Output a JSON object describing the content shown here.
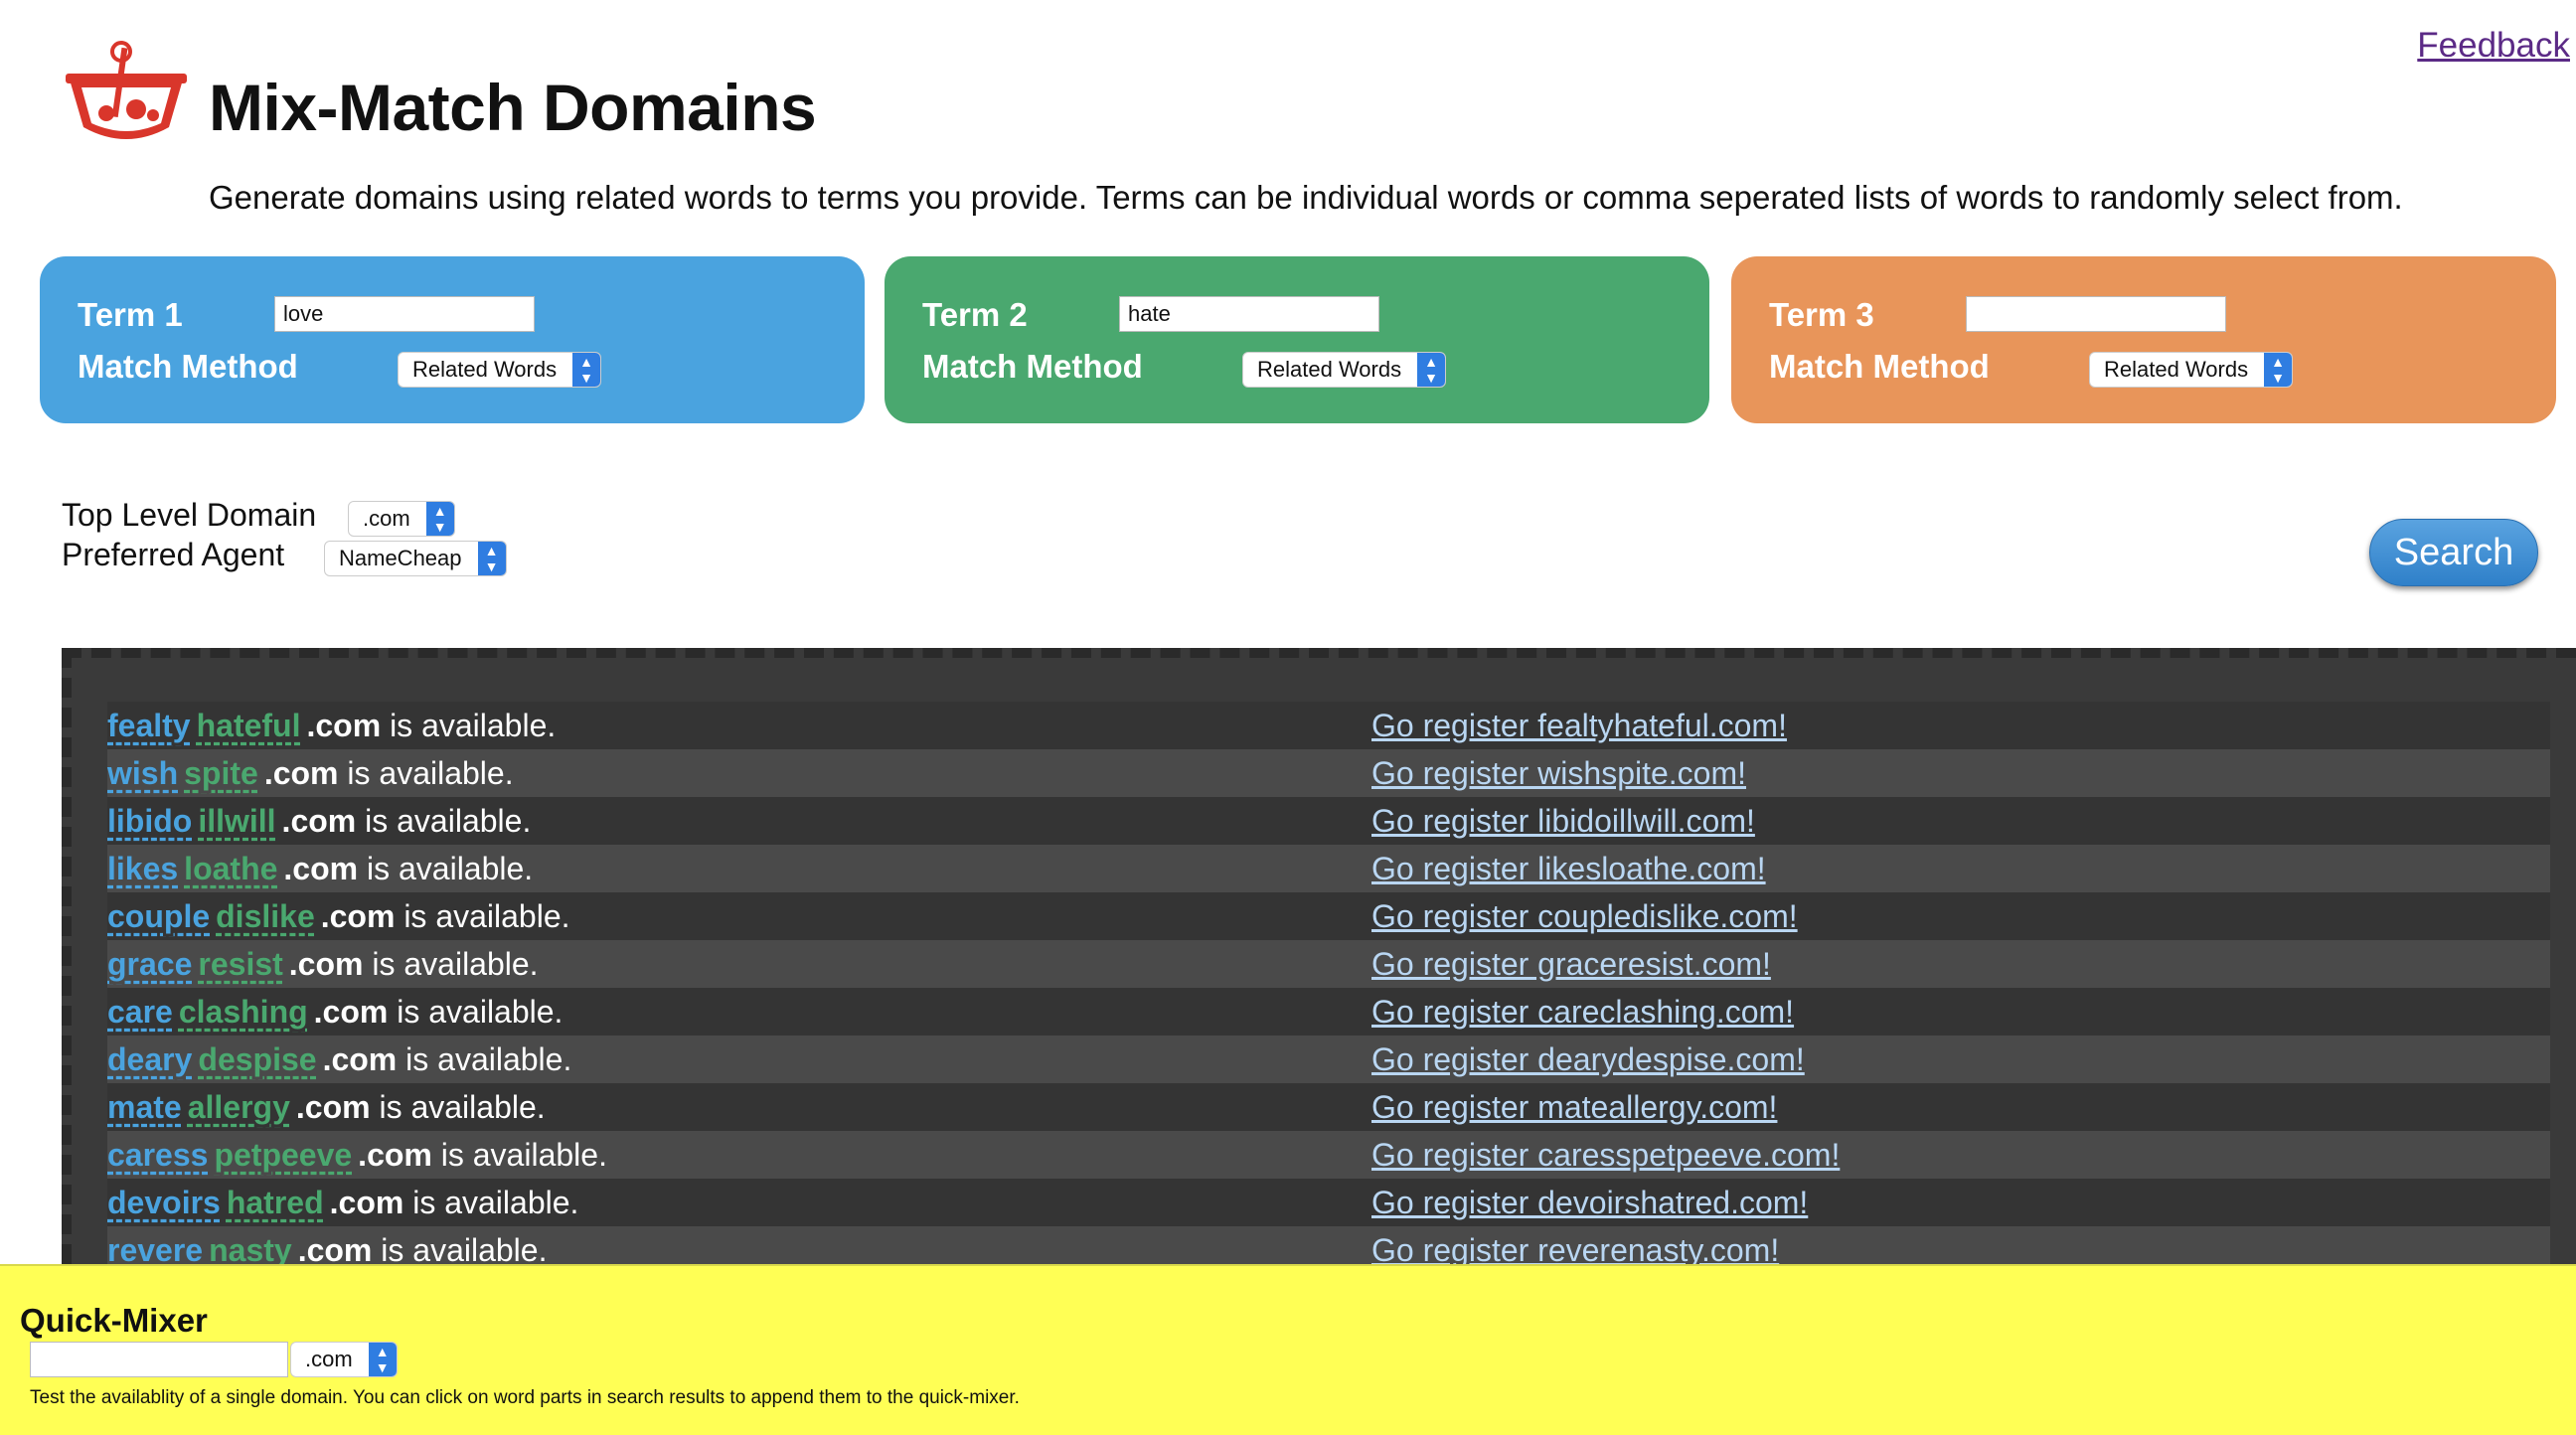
{
  "header": {
    "feedback_link": "Feedback",
    "title": "Mix-Match Domains",
    "subtitle": "Generate domains using related words to terms you provide. Terms can be individual words or comma seperated lists of words to randomly select from."
  },
  "colors": {
    "term1": "#4aa3df",
    "term2": "#4aa86f",
    "term3": "#e8955a",
    "results_bg": "#3a3a3a",
    "quick_mixer_bg": "#ffff55"
  },
  "terms": [
    {
      "label": "Term 1",
      "value": "love",
      "match_label": "Match Method",
      "method": "Related Words"
    },
    {
      "label": "Term 2",
      "value": "hate",
      "match_label": "Match Method",
      "method": "Related Words"
    },
    {
      "label": "Term 3",
      "value": "",
      "match_label": "Match Method",
      "method": "Related Words"
    }
  ],
  "options": {
    "tld_label": "Top Level Domain",
    "tld_value": ".com",
    "agent_label": "Preferred Agent",
    "agent_value": "NameCheap",
    "search_button": "Search"
  },
  "results": [
    {
      "word1": "fealty",
      "word2": "hateful",
      "tld": ".com",
      "status": " is available.",
      "register": "Go register fealtyhateful.com!"
    },
    {
      "word1": "wish",
      "word2": "spite",
      "tld": ".com",
      "status": " is available.",
      "register": "Go register wishspite.com!"
    },
    {
      "word1": "libido",
      "word2": "illwill",
      "tld": ".com",
      "status": " is available.",
      "register": "Go register libidoillwill.com!"
    },
    {
      "word1": "likes",
      "word2": "loathe",
      "tld": ".com",
      "status": " is available.",
      "register": "Go register likesloathe.com!"
    },
    {
      "word1": "couple",
      "word2": "dislike",
      "tld": ".com",
      "status": " is available.",
      "register": "Go register coupledislike.com!"
    },
    {
      "word1": "grace",
      "word2": "resist",
      "tld": ".com",
      "status": " is available.",
      "register": "Go register graceresist.com!"
    },
    {
      "word1": "care",
      "word2": "clashing",
      "tld": ".com",
      "status": " is available.",
      "register": "Go register careclashing.com!"
    },
    {
      "word1": "deary",
      "word2": "despise",
      "tld": ".com",
      "status": " is available.",
      "register": "Go register dearydespise.com!"
    },
    {
      "word1": "mate",
      "word2": "allergy",
      "tld": ".com",
      "status": " is available.",
      "register": "Go register mateallergy.com!"
    },
    {
      "word1": "caress",
      "word2": "petpeeve",
      "tld": ".com",
      "status": " is available.",
      "register": "Go register caresspetpeeve.com!"
    },
    {
      "word1": "devoirs",
      "word2": "hatred",
      "tld": ".com",
      "status": " is available.",
      "register": "Go register devoirshatred.com!"
    },
    {
      "word1": "revere",
      "word2": "nasty",
      "tld": ".com",
      "status": " is available.",
      "register": "Go register reverenasty.com!"
    }
  ],
  "quick_mixer": {
    "title": "Quick-Mixer",
    "input_value": "",
    "tld_value": ".com",
    "help": "Test the availablity of a single domain. You can click on word parts in search results to append them to the quick-mixer."
  }
}
